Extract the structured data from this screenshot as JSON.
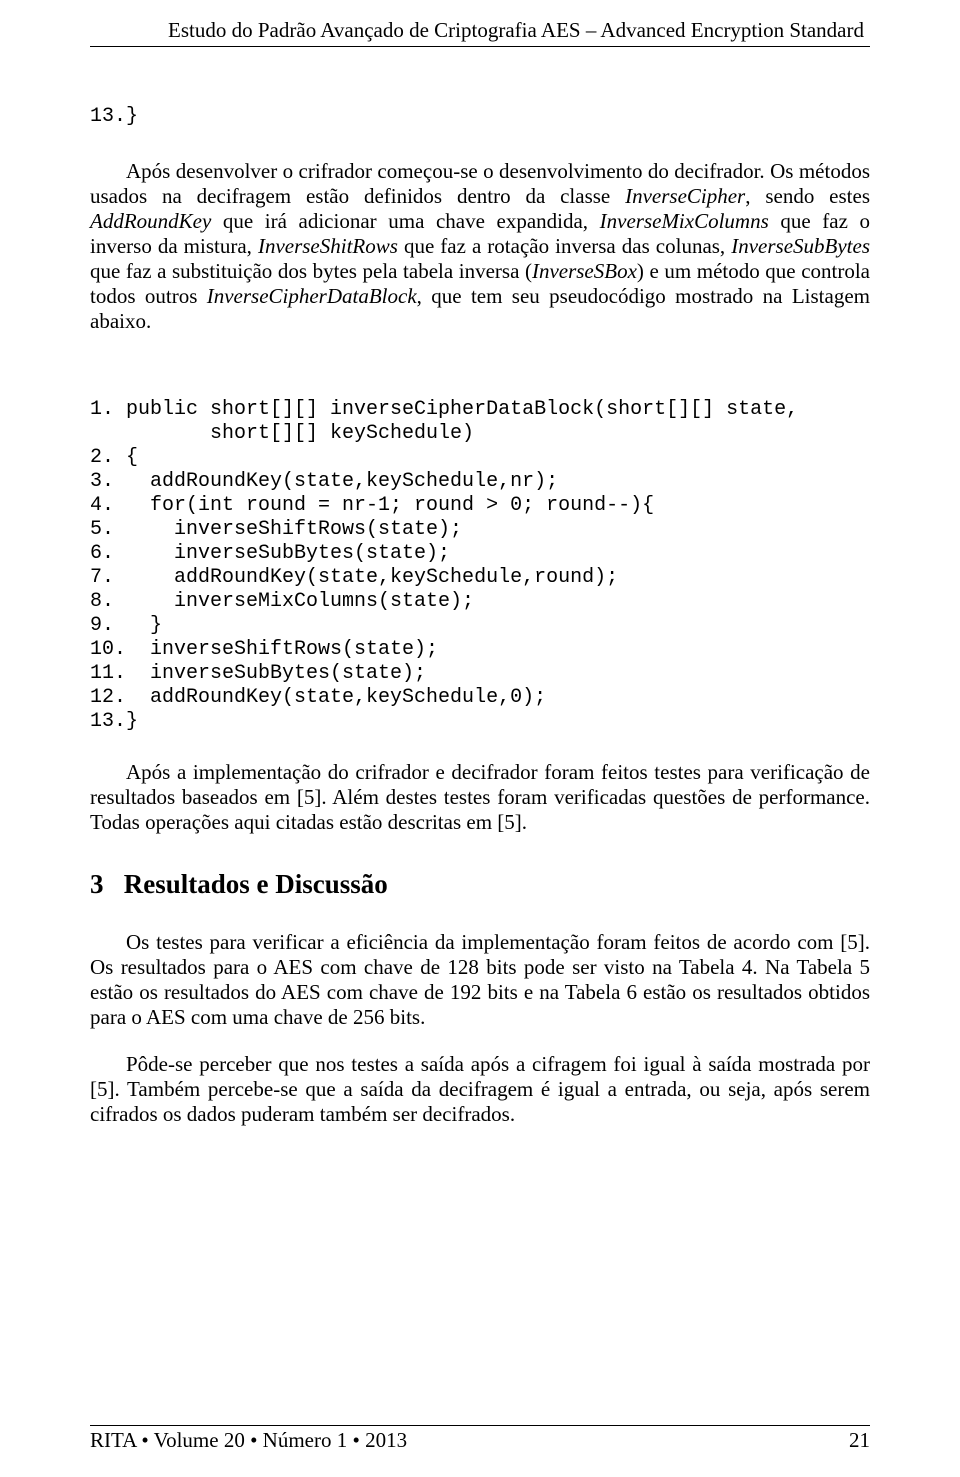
{
  "header": {
    "running_title": "Estudo do Padrão Avançado de Criptografia AES – Advanced Encryption Standard"
  },
  "pre_code_line": "13.}",
  "para1_html": "Após desenvolver o crifrador começou-se o desenvolvimento do decifrador. Os métodos usados na decifragem estão definidos dentro da classe <span class=\"italic\">InverseCipher</span>, sendo estes <span class=\"italic\">AddRoundKey</span> que irá adicionar uma chave expandida, <span class=\"italic\">InverseMixColumns</span> que faz o inverso da mistura, <span class=\"italic\">InverseShitRows</span> que faz a rotação inversa das colunas, <span class=\"italic\">InverseSubBytes</span> que faz a substituição dos bytes pela tabela inversa (<span class=\"italic\">InverseSBox</span>) e um método que controla todos outros <span class=\"italic\">InverseCipherDataBlock</span>, que tem seu pseudocódigo mostrado na Listagem abaixo.",
  "code_lines": [
    "1. public short[][] inverseCipherDataBlock(short[][] state,",
    "          short[][] keySchedule)",
    "2. {",
    "3.   addRoundKey(state,keySchedule,nr);",
    "4.   for(int round = nr-1; round > 0; round--){",
    "5.     inverseShiftRows(state);",
    "6.     inverseSubBytes(state);",
    "7.     addRoundKey(state,keySchedule,round);",
    "8.     inverseMixColumns(state);",
    "9.   }",
    "10.  inverseShiftRows(state);",
    "11.  inverseSubBytes(state);",
    "12.  addRoundKey(state,keySchedule,0);",
    "13.}"
  ],
  "para2": "Após a implementação do crifrador e decifrador foram feitos testes para verificação de resultados baseados em [5]. Além destes testes foram verificadas questões de performance. Todas operações aqui citadas estão descritas em [5].",
  "section": {
    "number": "3",
    "title": "Resultados e Discussão"
  },
  "para3": "Os testes para verificar a eficiência da implementação foram feitos de acordo com [5]. Os resultados para o AES com chave de 128 bits pode ser visto na Tabela 4. Na Tabela 5 estão os resultados do AES com chave de 192 bits e na Tabela 6 estão os resultados obtidos para o AES com uma chave de 256 bits.",
  "para4": "Pôde-se perceber que nos testes a saída após a cifragem foi igual à saída mostrada por [5]. Também percebe-se que a saída da decifragem é igual a entrada, ou seja, após serem cifrados os dados puderam também ser decifrados.",
  "footer": {
    "left": "RITA • Volume 20 • Número 1 • 2013",
    "right": "21"
  }
}
